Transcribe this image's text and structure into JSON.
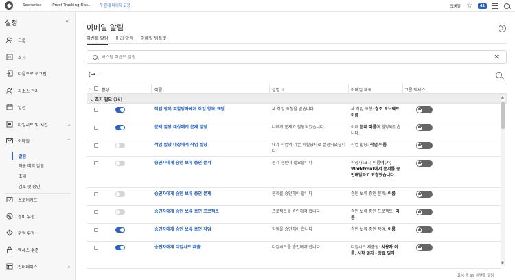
{
  "topbar": {
    "tabs": [
      "Scenarios",
      "Proof Tracking Das..."
    ],
    "pin_label": "현재 페이지 고정",
    "help_label": "도움말",
    "notification_count": "41"
  },
  "sidebar": {
    "title": "설정",
    "items": [
      {
        "label": "그룹",
        "icon": "group-icon"
      },
      {
        "label": "회사",
        "icon": "building-icon"
      },
      {
        "label": "다음으로 로그인",
        "icon": "login-icon"
      },
      {
        "label": "리소스 관리",
        "icon": "resource-icon"
      },
      {
        "label": "일정",
        "icon": "calendar-icon"
      },
      {
        "label": "타임시트 및 시간",
        "icon": "timesheet-icon"
      },
      {
        "label": "이메일",
        "icon": "email-icon"
      },
      {
        "label": "스코어카드",
        "icon": "scorecard-icon"
      },
      {
        "label": "경비 유형",
        "icon": "expense-icon"
      },
      {
        "label": "위험 유형",
        "icon": "risk-icon"
      },
      {
        "label": "액세스 수준",
        "icon": "lock-icon"
      },
      {
        "label": "인터페이스",
        "icon": "interface-icon"
      }
    ],
    "email_sub": [
      "알림",
      "자동 미리 알림",
      "초대",
      "검토 및 승인"
    ]
  },
  "main": {
    "title": "이메일 알림",
    "tabs": [
      "이벤트 알림",
      "미리 알림",
      "이메일 템플릿"
    ],
    "search_placeholder": "시스템 이벤트 알림",
    "columns": [
      "활성",
      "이름",
      "설명 ↑",
      "이메일 제목",
      "그룹 액세스"
    ],
    "group": {
      "label": "조치 필요",
      "count": "(16)"
    },
    "rows": [
      {
        "active": true,
        "name": "작업 항목 피할당자에게 작업 항목 요청",
        "desc": "새 작업 요청을 받습니다.",
        "subject": [
          "새 작업 요청: ",
          "참조 오브젝트",
          ":",
          "이름"
        ]
      },
      {
        "active": true,
        "name": "문제 할당 대상에게 문제 할당",
        "desc": "나에게 문제가 할당되었습니다.",
        "subject": [
          "이제 ",
          "문제",
          ":",
          "이름",
          "에 할당되었습니다."
        ]
      },
      {
        "active": false,
        "name": "작업 할당 대상에게 작업 할당",
        "desc": "내가 작업의 기본 피할당자로 설정되었습니다.",
        "subject": [
          "작업 할당: ",
          "작업",
          ":",
          "이름"
        ]
      },
      {
        "active": false,
        "name": "승인자에게 승인 보류 중인 문서",
        "desc": "문서 승인이 필요합니다",
        "subject": [
          "작성자",
          ":",
          "표시 이름",
          "이(가) Workfront에서 문서를 승인해달라고 요청했습니다."
        ]
      },
      {
        "active": false,
        "name": "승인자에게 승인 보류 중인 문제",
        "desc": "문제를 승인해야 합니다",
        "subject": [
          "승인 보류 중인 문제: ",
          "이름",
          "",
          "",
          ""
        ]
      },
      {
        "active": false,
        "name": "승인자에게 승인 보류 중인 프로젝트",
        "desc": "프로젝트를 승인해야 합니다",
        "subject": [
          "승인 보류 중인 프로젝트: ",
          "이름",
          "",
          "",
          ""
        ]
      },
      {
        "active": true,
        "name": "승인자에게 승인 보류 중인 작업",
        "desc": "작업을 승인해야 합니다",
        "subject": [
          "승인 보류 중인 작업: ",
          "이름",
          "",
          "",
          ""
        ]
      },
      {
        "active": true,
        "name": "승인자에게 타임시트 제출",
        "desc": "타임시트를 승인해야 합니다",
        "subject": [
          "타임시트 제출됨: ",
          "사용자",
          ":",
          "이름",
          ", ",
          "시작 일자",
          " - ",
          "종료 일자"
        ]
      }
    ],
    "footer": "표시 중 99 이벤트 알림"
  },
  "colors": {
    "accent": "#2d62c9",
    "link": "#1c5ec2"
  }
}
